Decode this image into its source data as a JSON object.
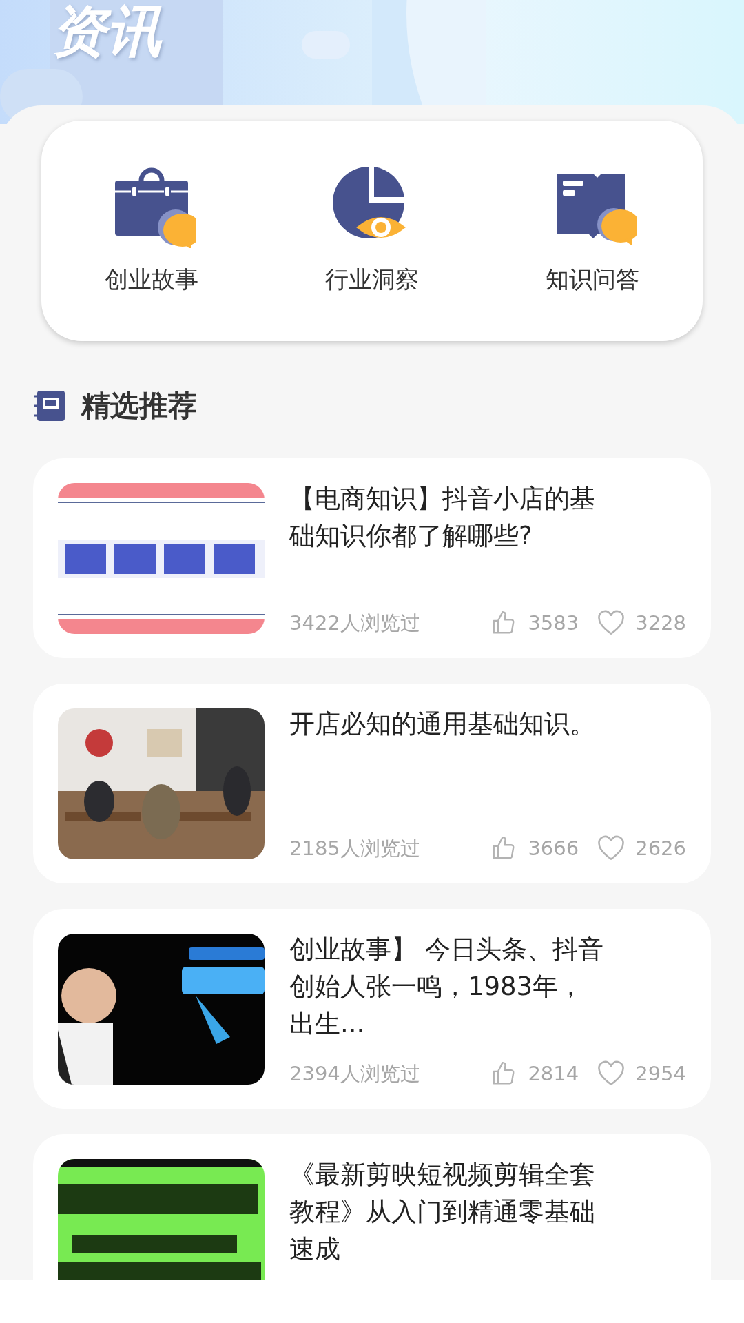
{
  "header": {
    "title": "资讯"
  },
  "categories": [
    {
      "label": "创业故事",
      "kind": "briefcase"
    },
    {
      "label": "行业洞察",
      "kind": "chart"
    },
    {
      "label": "知识问答",
      "kind": "book"
    }
  ],
  "section": {
    "title": "精选推荐"
  },
  "articles": [
    {
      "title": "【电商知识】抖音小店的基础知识你都了解哪些?",
      "views": "3422人浏览过",
      "likes": "3583",
      "favorites": "3228"
    },
    {
      "title": "开店必知的通用基础知识。",
      "views": "2185人浏览过",
      "likes": "3666",
      "favorites": "2626"
    },
    {
      "title": "创业故事】 今日头条、抖音创始人张一鸣，1983年，出生...",
      "views": "2394人浏览过",
      "likes": "2814",
      "favorites": "2954"
    },
    {
      "title": "《最新剪映短视频剪辑全套教程》从入门到精通零基础速成"
    }
  ]
}
